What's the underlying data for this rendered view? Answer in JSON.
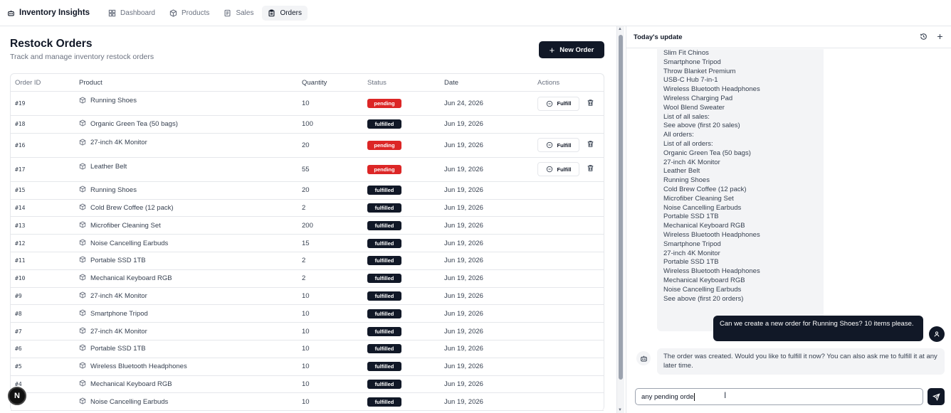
{
  "app": {
    "title": "Inventory Insights"
  },
  "nav": [
    {
      "label": "Dashboard",
      "icon": "grid-icon",
      "active": false
    },
    {
      "label": "Products",
      "icon": "box-icon",
      "active": false
    },
    {
      "label": "Sales",
      "icon": "receipt-icon",
      "active": false
    },
    {
      "label": "Orders",
      "icon": "clipboard-icon",
      "active": true
    }
  ],
  "page": {
    "title": "Restock Orders",
    "subtitle": "Track and manage inventory restock orders",
    "new_order_label": "New Order"
  },
  "table": {
    "columns": [
      "Order ID",
      "Product",
      "Quantity",
      "Status",
      "Date",
      "Actions"
    ],
    "fulfill_label": "Fulfill",
    "rows": [
      {
        "id": "#19",
        "product": "Running Shoes",
        "quantity": "10",
        "status": "pending",
        "date": "Jun 24, 2026"
      },
      {
        "id": "#18",
        "product": "Organic Green Tea (50 bags)",
        "quantity": "100",
        "status": "fulfilled",
        "date": "Jun 19, 2026"
      },
      {
        "id": "#16",
        "product": "27-inch 4K Monitor",
        "quantity": "20",
        "status": "pending",
        "date": "Jun 19, 2026"
      },
      {
        "id": "#17",
        "product": "Leather Belt",
        "quantity": "55",
        "status": "pending",
        "date": "Jun 19, 2026"
      },
      {
        "id": "#15",
        "product": "Running Shoes",
        "quantity": "20",
        "status": "fulfilled",
        "date": "Jun 19, 2026"
      },
      {
        "id": "#14",
        "product": "Cold Brew Coffee (12 pack)",
        "quantity": "2",
        "status": "fulfilled",
        "date": "Jun 19, 2026"
      },
      {
        "id": "#13",
        "product": "Microfiber Cleaning Set",
        "quantity": "200",
        "status": "fulfilled",
        "date": "Jun 19, 2026"
      },
      {
        "id": "#12",
        "product": "Noise Cancelling Earbuds",
        "quantity": "15",
        "status": "fulfilled",
        "date": "Jun 19, 2026"
      },
      {
        "id": "#11",
        "product": "Portable SSD 1TB",
        "quantity": "2",
        "status": "fulfilled",
        "date": "Jun 19, 2026"
      },
      {
        "id": "#10",
        "product": "Mechanical Keyboard RGB",
        "quantity": "2",
        "status": "fulfilled",
        "date": "Jun 19, 2026"
      },
      {
        "id": "#9",
        "product": "27-inch 4K Monitor",
        "quantity": "10",
        "status": "fulfilled",
        "date": "Jun 19, 2026"
      },
      {
        "id": "#8",
        "product": "Smartphone Tripod",
        "quantity": "10",
        "status": "fulfilled",
        "date": "Jun 19, 2026"
      },
      {
        "id": "#7",
        "product": "27-inch 4K Monitor",
        "quantity": "10",
        "status": "fulfilled",
        "date": "Jun 19, 2026"
      },
      {
        "id": "#6",
        "product": "Portable SSD 1TB",
        "quantity": "10",
        "status": "fulfilled",
        "date": "Jun 19, 2026"
      },
      {
        "id": "#5",
        "product": "Wireless Bluetooth Headphones",
        "quantity": "10",
        "status": "fulfilled",
        "date": "Jun 19, 2026"
      },
      {
        "id": "#4",
        "product": "Mechanical Keyboard RGB",
        "quantity": "10",
        "status": "fulfilled",
        "date": "Jun 19, 2026"
      },
      {
        "id": "",
        "product": "Noise Cancelling Earbuds",
        "quantity": "10",
        "status": "fulfilled",
        "date": "Jun 19, 2026"
      }
    ]
  },
  "floating_badge": "N",
  "panel": {
    "title": "Today's update",
    "ai_list_lines": [
      "Slim Fit Chinos",
      "Smartphone Tripod",
      "Throw Blanket Premium",
      "USB-C Hub 7-in-1",
      "Wireless Bluetooth Headphones",
      "Wireless Charging Pad",
      "Wool Blend Sweater",
      "List of all sales:",
      "See above (first 20 sales)",
      "All orders:",
      "List of all orders:",
      "Organic Green Tea (50 bags)",
      "27-inch 4K Monitor",
      "Leather Belt",
      "Running Shoes",
      "Cold Brew Coffee (12 pack)",
      "Microfiber Cleaning Set",
      "Noise Cancelling Earbuds",
      "Portable SSD 1TB",
      "Mechanical Keyboard RGB",
      "Wireless Bluetooth Headphones",
      "Smartphone Tripod",
      "27-inch 4K Monitor",
      "Portable SSD 1TB",
      "Wireless Bluetooth Headphones",
      "Mechanical Keyboard RGB",
      "Noise Cancelling Earbuds",
      "See above (first 20 orders)"
    ],
    "user_message": "Can we create a new order for Running Shoes? 10 items please.",
    "ai_message": "The order was created. Would you like to fulfill it now? You can also ask me to fulfill it at any later time.",
    "input_value": "any pending orde"
  }
}
